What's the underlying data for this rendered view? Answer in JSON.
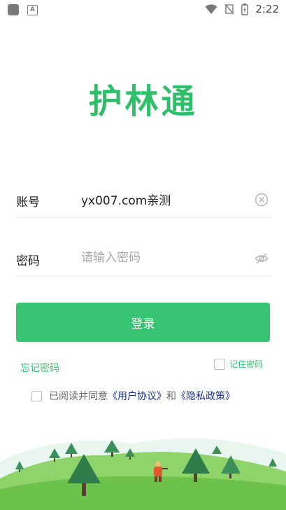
{
  "status_bar": {
    "time": "2:22",
    "notif_letter": "A"
  },
  "app": {
    "title": "护林通"
  },
  "form": {
    "account_label": "账号",
    "account_value": "yx007.com亲测",
    "password_label": "密码",
    "password_placeholder": "请输入密码",
    "login_button": "登录"
  },
  "links": {
    "forgot_password": "忘记密码",
    "remember_password": "记住密码"
  },
  "agreement": {
    "prefix": "已阅读并同意",
    "user_agreement": "《用户协议》",
    "and": "和",
    "privacy_policy": "《隐私政策》"
  },
  "colors": {
    "accent": "#36c372",
    "title": "#2fbf6b",
    "link": "#1a2f8e"
  }
}
